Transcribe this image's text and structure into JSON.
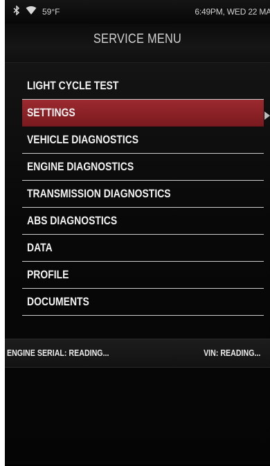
{
  "status_bar": {
    "temperature": "59°F",
    "clock": "6:49PM, WED 22 MA",
    "icons": [
      "bluetooth-icon",
      "wifi-icon"
    ]
  },
  "header": {
    "title": "SERVICE MENU"
  },
  "menu": {
    "items": [
      {
        "label": "LIGHT CYCLE TEST"
      },
      {
        "label": "SETTINGS"
      },
      {
        "label": "VEHICLE DIAGNOSTICS"
      },
      {
        "label": "ENGINE DIAGNOSTICS"
      },
      {
        "label": "TRANSMISSION DIAGNOSTICS"
      },
      {
        "label": "ABS DIAGNOSTICS"
      },
      {
        "label": "DATA"
      },
      {
        "label": "PROFILE"
      },
      {
        "label": "DOCUMENTS"
      }
    ],
    "selected_label": "SETTINGS"
  },
  "info_bar": {
    "engine_serial": "ENGINE SERIAL: READING...",
    "vin": "VIN: READING..."
  },
  "colors": {
    "selected_bg": "#8b2126",
    "background": "#000000",
    "text": "#f2f2f2"
  }
}
